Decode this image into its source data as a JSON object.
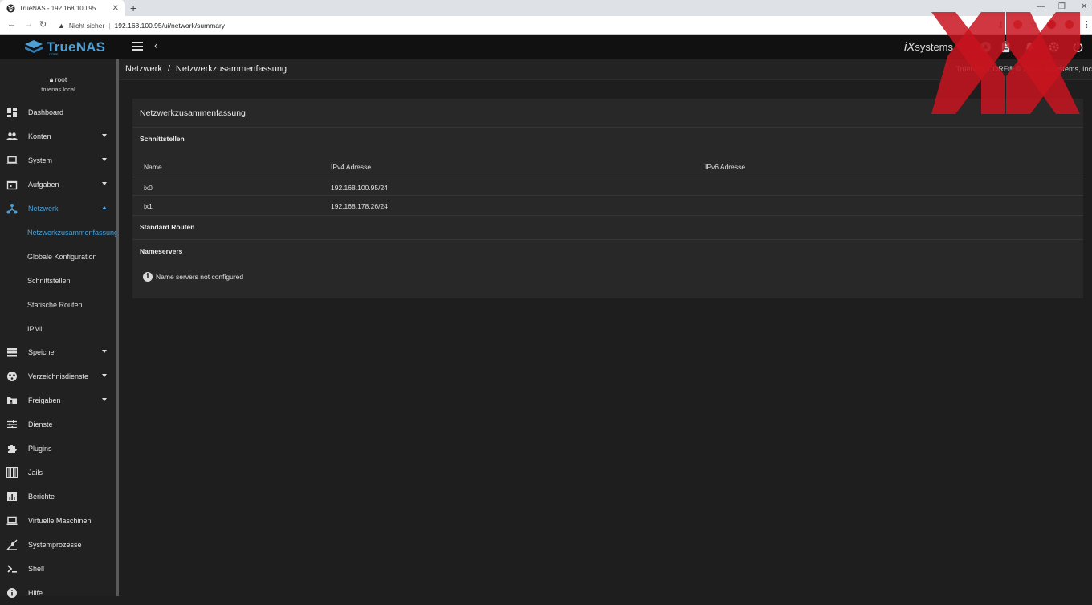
{
  "browser": {
    "tab_title": "TrueNAS - 192.168.100.95",
    "tab_close": "✕",
    "new_tab": "+",
    "security_label": "Nicht sicher",
    "url": "192.168.100.95/ui/network/summary"
  },
  "app": {
    "logo": "TrueNAS",
    "logo_sub": "CORE",
    "vendor_logo_ix": "iX",
    "vendor_logo_systems": "systems",
    "copyright": "TrueNAS CORE® © 2020 - iXsystems, Inc"
  },
  "breadcrumb": {
    "parent": "Netzwerk",
    "separator": "/",
    "current": "Netzwerkzusammenfassung"
  },
  "user": {
    "name": "root",
    "host": "truenas.local"
  },
  "sidebar": {
    "items": [
      {
        "label": "Dashboard",
        "icon": "dashboard-icon"
      },
      {
        "label": "Konten",
        "icon": "accounts-icon"
      },
      {
        "label": "System",
        "icon": "system-icon"
      },
      {
        "label": "Aufgaben",
        "icon": "tasks-icon"
      },
      {
        "label": "Netzwerk",
        "icon": "network-icon"
      },
      {
        "label": "Speicher",
        "icon": "storage-icon"
      },
      {
        "label": "Verzeichnisdienste",
        "icon": "directory-services-icon"
      },
      {
        "label": "Freigaben",
        "icon": "shares-icon"
      },
      {
        "label": "Dienste",
        "icon": "services-icon"
      },
      {
        "label": "Plugins",
        "icon": "plugins-icon"
      },
      {
        "label": "Jails",
        "icon": "jails-icon"
      },
      {
        "label": "Berichte",
        "icon": "reports-icon"
      },
      {
        "label": "Virtuelle Maschinen",
        "icon": "vm-icon"
      },
      {
        "label": "Systemprozesse",
        "icon": "system-processes-icon"
      },
      {
        "label": "Shell",
        "icon": "shell-icon"
      },
      {
        "label": "Hilfe",
        "icon": "help-icon"
      }
    ],
    "network_sub": [
      {
        "label": "Netzwerkzusammenfassung"
      },
      {
        "label": "Globale Konfiguration"
      },
      {
        "label": "Schnittstellen"
      },
      {
        "label": "Statische Routen"
      },
      {
        "label": "IPMI"
      }
    ]
  },
  "card": {
    "title": "Netzwerkzusammenfassung",
    "interfaces_title": "Schnittstellen",
    "columns": [
      "Name",
      "IPv4 Adresse",
      "IPv6 Adresse"
    ],
    "rows": [
      {
        "name": "ix0",
        "ipv4": "192.168.100.95/24",
        "ipv6": ""
      },
      {
        "name": "ix1",
        "ipv4": "192.168.178.26/24",
        "ipv6": ""
      }
    ],
    "routes_title": "Standard Routen",
    "nameservers_title": "Nameservers",
    "nameservers_info_icon": "i",
    "nameservers_empty": "Name servers not configured"
  },
  "colors": {
    "accent": "#4e9fd4",
    "background": "#1e1e1e",
    "card": "#282828",
    "watermark": "#c8141e"
  }
}
